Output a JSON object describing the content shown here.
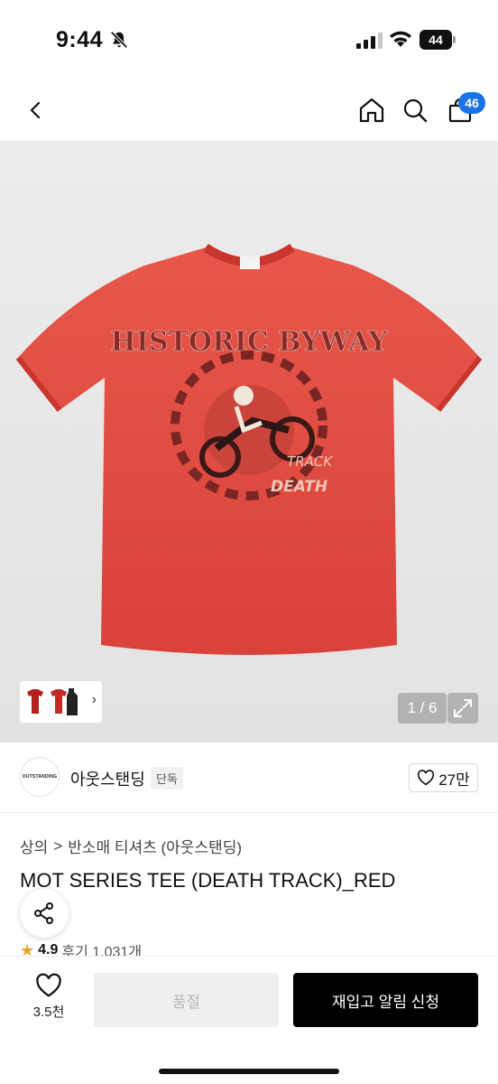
{
  "status_bar": {
    "time": "9:44",
    "battery": "44",
    "icons": [
      "bell-slash-icon",
      "signal-icon",
      "wifi-icon",
      "battery-icon"
    ]
  },
  "nav": {
    "icons": [
      "chevron-left-icon",
      "home-icon",
      "search-icon",
      "shopping-bag-icon"
    ],
    "cart_count": "46"
  },
  "gallery": {
    "counter": "1 / 6",
    "thumbnail_arrow": "›"
  },
  "brand": {
    "logo_text": "OUTSTANDING",
    "name": "아웃스탠딩",
    "badge": "단독",
    "likes": "27만"
  },
  "product": {
    "breadcrumb": [
      "상의",
      "반소매 티셔츠 (아웃스탠딩)"
    ],
    "breadcrumb_sep": ">",
    "title": "MOT SERIES TEE (DEATH TRACK)_RED",
    "rating": "4.9",
    "reviews": "후기 1,031개"
  },
  "bottom_bar": {
    "wishlist_count": "3.5천",
    "soldout_label": "품절",
    "restock_label": "재입고 알림 신청"
  },
  "colors": {
    "accent": "#1a73e8",
    "shirt": "#e2483b",
    "cta": "#000000"
  }
}
